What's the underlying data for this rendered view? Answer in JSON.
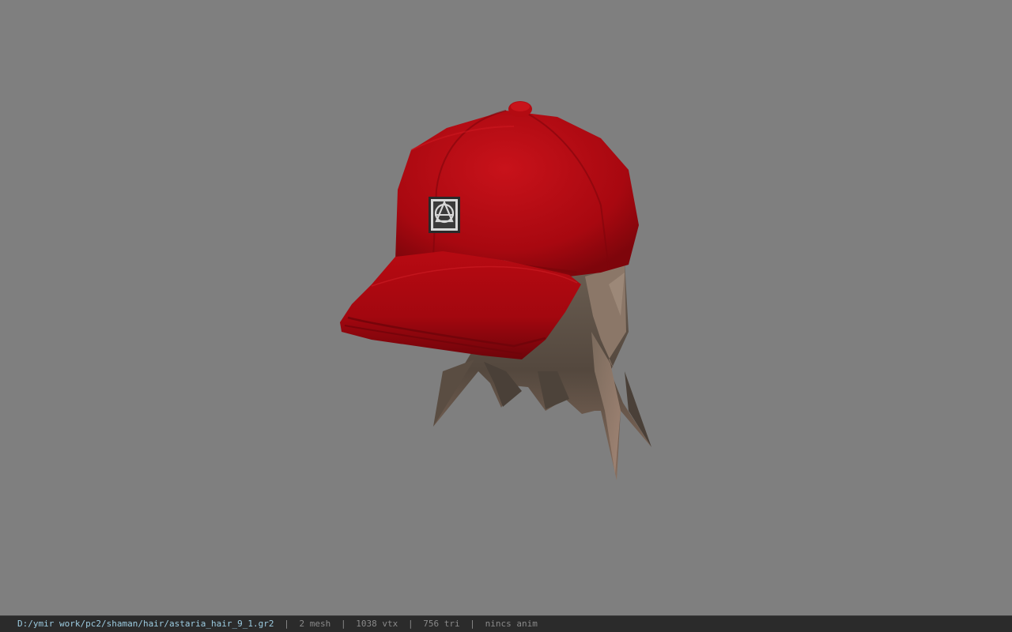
{
  "viewport": {
    "model_name": "cap-with-hair-model",
    "background_color": "#7f7f7f",
    "cap_color": "#c00a10",
    "hair_color": "#5e5247"
  },
  "statusbar": {
    "file_path": "D:/ymir work/pc2/shaman/hair/astaria_hair_9_1.gr2",
    "separator": "|",
    "mesh_count": "2 mesh",
    "vertex_count": "1038 vtx",
    "triangle_count": "756 tri",
    "animation": "nincs anim"
  }
}
